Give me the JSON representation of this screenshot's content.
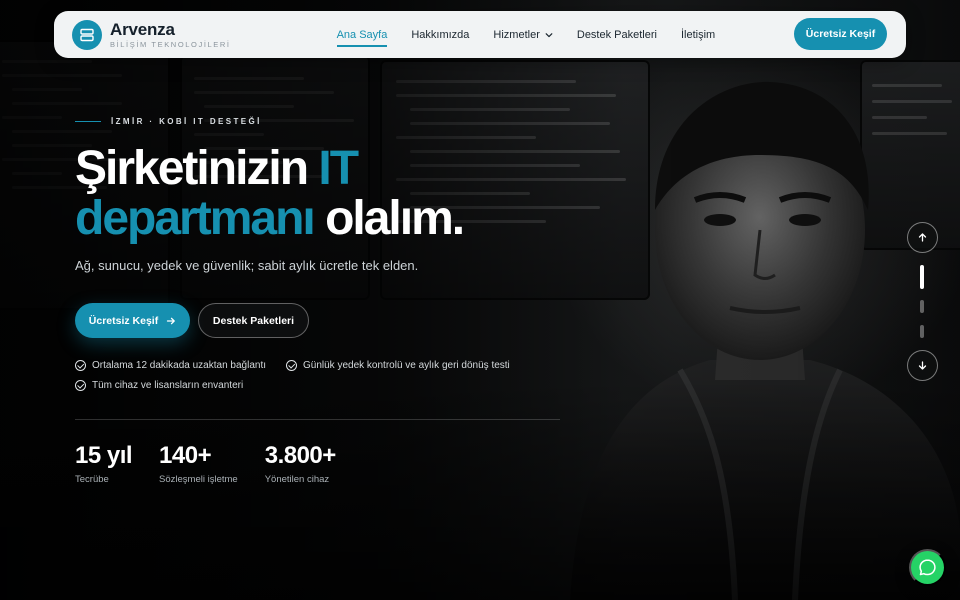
{
  "brand": {
    "name": "Arvenza",
    "tagline": "BİLİŞİM TEKNOLOJİLERİ",
    "accent_color": "#1690b0",
    "logo_icon": "server-icon"
  },
  "nav": {
    "items": [
      {
        "label": "Ana Sayfa",
        "active": true
      },
      {
        "label": "Hakkımızda",
        "active": false
      },
      {
        "label": "Hizmetler",
        "active": false,
        "dropdown": true
      },
      {
        "label": "Destek Paketleri",
        "active": false
      },
      {
        "label": "İletişim",
        "active": false
      }
    ],
    "cta_label": "Ücretsiz Keşif"
  },
  "hero": {
    "eyebrow": "İZMİR · KOBİ IT DESTEĞİ",
    "headline": {
      "line1_plain": "Şirketinizin ",
      "line1_accent": "IT",
      "line2_accent": "departmanı",
      "line2_plain": " olalım."
    },
    "subtitle": "Ağ, sunucu, yedek ve güvenlik; sabit aylık ücretle tek elden.",
    "primary_button": "Ücretsiz Keşif",
    "secondary_button": "Destek Paketleri",
    "features": [
      "Ortalama 12 dakikada uzaktan bağlantı",
      "Günlük yedek kontrolü ve aylık geri dönüş testi",
      "Tüm cihaz ve lisansların envanteri"
    ],
    "stats": [
      {
        "value": "15 yıl",
        "label": "Tecrübe"
      },
      {
        "value": "140+",
        "label": "Sözleşmeli işletme"
      },
      {
        "value": "3.800+",
        "label": "Yönetilen cihaz"
      }
    ]
  },
  "slider": {
    "up_icon": "arrow-up-icon",
    "down_icon": "arrow-down-icon",
    "slide_count": 3,
    "active_slide": 1
  },
  "chat": {
    "icon": "whatsapp-icon",
    "color": "#25d366"
  }
}
